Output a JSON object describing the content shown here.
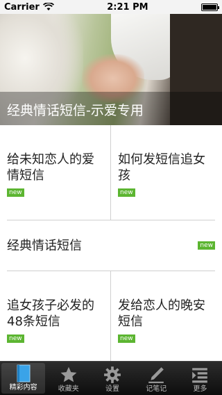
{
  "status": {
    "carrier": "Carrier",
    "time": "2:21 PM",
    "battery_level": 1.0
  },
  "hero": {
    "caption": "经典情话短信-示爱专用"
  },
  "cards": [
    {
      "title": "给未知恋人的爱情短信",
      "badge": "new"
    },
    {
      "title": "如何发短信追女孩",
      "badge": "new"
    },
    {
      "title": "经典情话短信",
      "badge": "new"
    },
    {
      "title": "追女孩子必发的48条短信",
      "badge": "new"
    },
    {
      "title": "发给恋人的晚安短信",
      "badge": "new"
    }
  ],
  "tabs": [
    {
      "label": "精彩内容",
      "icon": "book-icon"
    },
    {
      "label": "收藏夹",
      "icon": "star-icon"
    },
    {
      "label": "设置",
      "icon": "gear-icon"
    },
    {
      "label": "记笔记",
      "icon": "pen-icon"
    },
    {
      "label": "更多",
      "icon": "more-list-icon"
    }
  ],
  "colors": {
    "badge": "#5cb531",
    "tab_bar": "#1a1a1a",
    "active_tab_icon": "#3aa3e8"
  }
}
